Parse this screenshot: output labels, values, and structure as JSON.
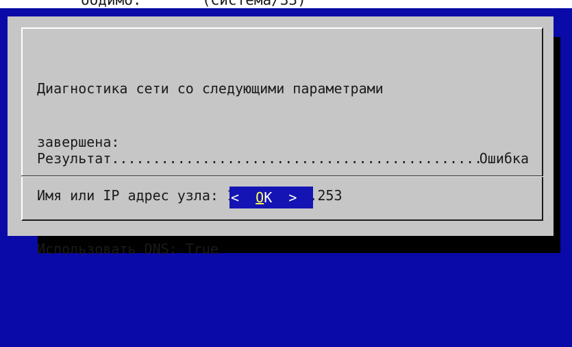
{
  "background_strip": {
    "text": "бодимо:       (Система/ЗЗ)"
  },
  "dialog": {
    "message_lines": [
      "Диагностика сети со следующими параметрами",
      "завершена:",
      "Имя или IP адрес узла: 198.51.100.253",
      "Использовать DNS: True",
      ""
    ],
    "result": {
      "label": "Результат",
      "dots": "..................................................................",
      "value": "Ошибка"
    },
    "ok_button": {
      "left": "<",
      "hotkey": "O",
      "rest": "K",
      "right": ">"
    }
  },
  "colors": {
    "background": "#0a0aa8",
    "dialog": "#c6c6c6",
    "button_bg": "#1414b4",
    "hotkey": "#ffff54",
    "shadow": "#000000"
  }
}
